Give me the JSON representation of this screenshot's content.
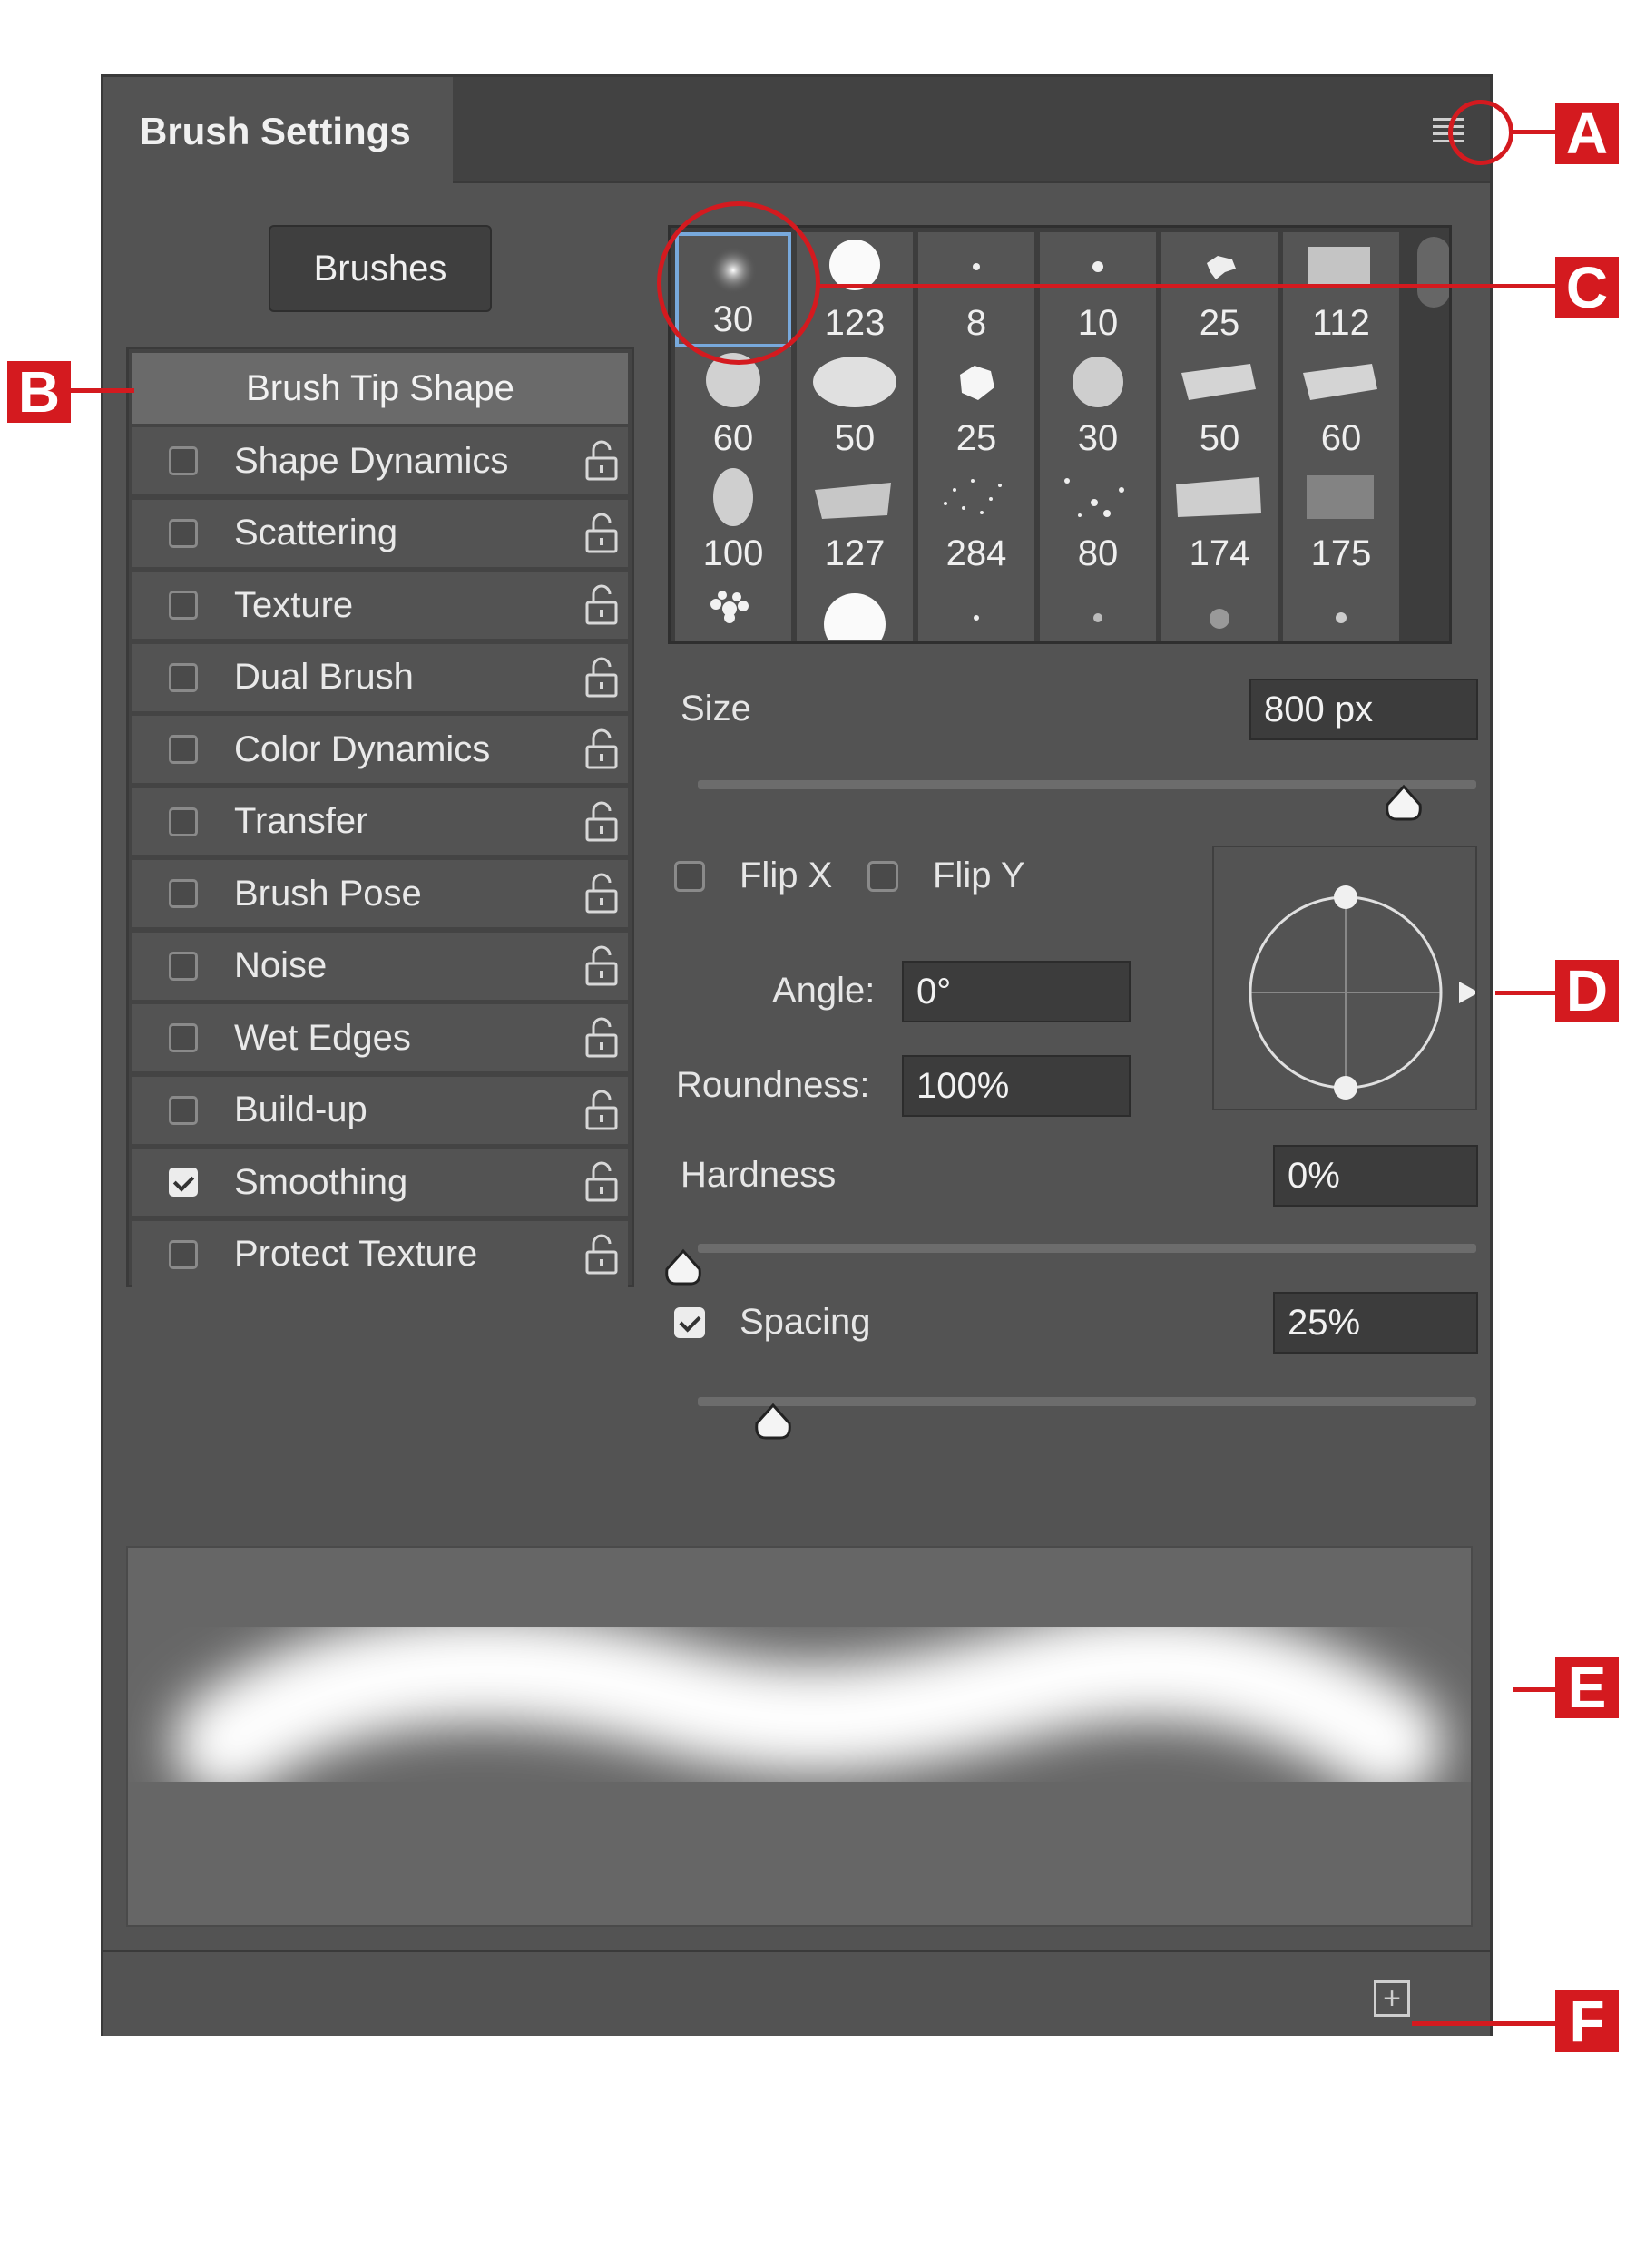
{
  "panel": {
    "tab_title": "Brush Settings"
  },
  "brushes_button": "Brushes",
  "sidebar": {
    "header": "Brush Tip Shape",
    "items": [
      {
        "label": "Shape Dynamics",
        "checked": false
      },
      {
        "label": "Scattering",
        "checked": false
      },
      {
        "label": "Texture",
        "checked": false
      },
      {
        "label": "Dual Brush",
        "checked": false
      },
      {
        "label": "Color Dynamics",
        "checked": false
      },
      {
        "label": "Transfer",
        "checked": false
      },
      {
        "label": "Brush Pose",
        "checked": false
      },
      {
        "label": "Noise",
        "checked": false
      },
      {
        "label": "Wet Edges",
        "checked": false
      },
      {
        "label": "Build-up",
        "checked": false
      },
      {
        "label": "Smoothing",
        "checked": true
      },
      {
        "label": "Protect Texture",
        "checked": false
      }
    ]
  },
  "brush_presets": [
    "30",
    "123",
    "8",
    "10",
    "25",
    "112",
    "60",
    "50",
    "25",
    "30",
    "50",
    "60",
    "100",
    "127",
    "284",
    "80",
    "174",
    "175"
  ],
  "size": {
    "label": "Size",
    "value": "800 px"
  },
  "flip_x": {
    "label": "Flip X",
    "checked": false
  },
  "flip_y": {
    "label": "Flip Y",
    "checked": false
  },
  "angle": {
    "label": "Angle:",
    "value": "0°"
  },
  "roundness": {
    "label": "Roundness:",
    "value": "100%"
  },
  "hardness": {
    "label": "Hardness",
    "value": "0%"
  },
  "spacing": {
    "label": "Spacing",
    "value": "25%",
    "checked": true
  },
  "callouts": {
    "a": "A",
    "b": "B",
    "c": "C",
    "d": "D",
    "e": "E",
    "f": "F"
  },
  "new_brush_icon": "+",
  "colors": {
    "callout": "#d41a1f",
    "selection": "#78a9dc",
    "panel": "#535353"
  }
}
